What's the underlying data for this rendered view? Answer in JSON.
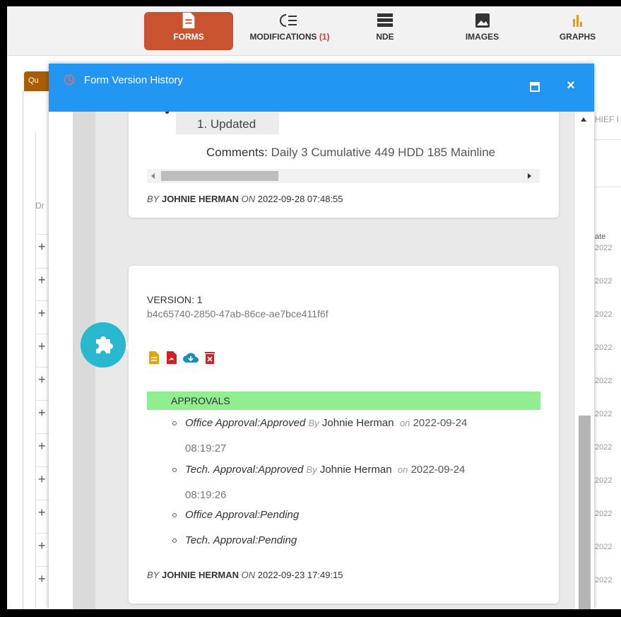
{
  "nav": {
    "forms": "FORMS",
    "modifications": "MODIFICATIONS",
    "modifications_count": "(1)",
    "nde": "NDE",
    "images": "IMAGES",
    "graphs": "GRAPHS"
  },
  "background": {
    "tab_label": "Qu",
    "col_label": "Dr",
    "header_fragment": "HIEF I",
    "date_header": "ate",
    "year_fragment": "2022"
  },
  "modal": {
    "title": "Form Version History",
    "close_label": "×"
  },
  "card_top": {
    "bullet_text": "1. Updated",
    "comments_label": "Comments:",
    "comments_value": "Daily 3 Cumulative 449 HDD 185 Mainline",
    "by_label": "BY",
    "author": "JOHNIE HERMAN",
    "on_label": "ON",
    "timestamp": "2022-09-28 07:48:55"
  },
  "card_version": {
    "version_label": "VERSION: 1",
    "version_id": "b4c65740-2850-47ab-86ce-ae7bce411f6f",
    "actions": [
      "document-icon",
      "pdf-icon",
      "cloud-download-icon",
      "delete-icon"
    ],
    "approvals_title": "APPROVALS",
    "approvals": [
      {
        "status": "Office Approval:Approved",
        "by": "By",
        "name": "Johnie Herman",
        "on": "on",
        "date": "2022-09-24",
        "time": "08:19:27"
      },
      {
        "status": "Tech. Approval:Approved",
        "by": "By",
        "name": "Johnie Herman",
        "on": "on",
        "date": "2022-09-24",
        "time": "08:19:26"
      },
      {
        "status": "Office Approval:Pending"
      },
      {
        "status": "Tech. Approval:Pending"
      }
    ],
    "by_label": "BY",
    "author": "JOHNIE HERMAN",
    "on_label": "ON",
    "timestamp": "2022-09-23 17:49:15"
  },
  "colors": {
    "modal_header": "#2196f3",
    "forms_active": "#c9532e",
    "approvals_bar": "#90ee90",
    "timeline_badge": "#2ab8cf"
  }
}
